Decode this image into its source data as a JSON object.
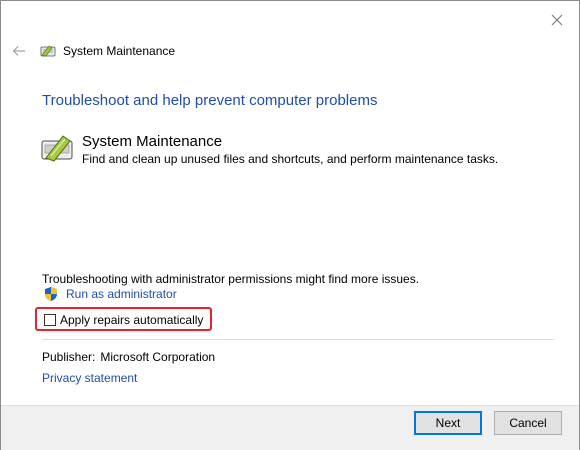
{
  "window": {
    "title": "System Maintenance"
  },
  "heading": "Troubleshoot and help prevent computer problems",
  "troubleshooter": {
    "name": "System Maintenance",
    "description": "Find and clean up unused files and shortcuts, and perform maintenance tasks."
  },
  "admin": {
    "note": "Troubleshooting with administrator permissions might find more issues.",
    "run_label": "Run as administrator"
  },
  "apply_repairs": {
    "label": "Apply repairs automatically",
    "checked": false
  },
  "publisher": {
    "label": "Publisher:",
    "value": "Microsoft Corporation"
  },
  "privacy_link": "Privacy statement",
  "buttons": {
    "next": "Next",
    "cancel": "Cancel"
  },
  "colors": {
    "link": "#1e4fa3",
    "highlight_border": "#e8232a",
    "primary_button_border": "#0078d7",
    "footer_bg": "#f0f0f0"
  },
  "icons": {
    "close": "close-icon",
    "back": "back-arrow-icon",
    "title": "system-maintenance-icon",
    "tool": "system-maintenance-icon",
    "admin": "uac-shield-icon"
  }
}
